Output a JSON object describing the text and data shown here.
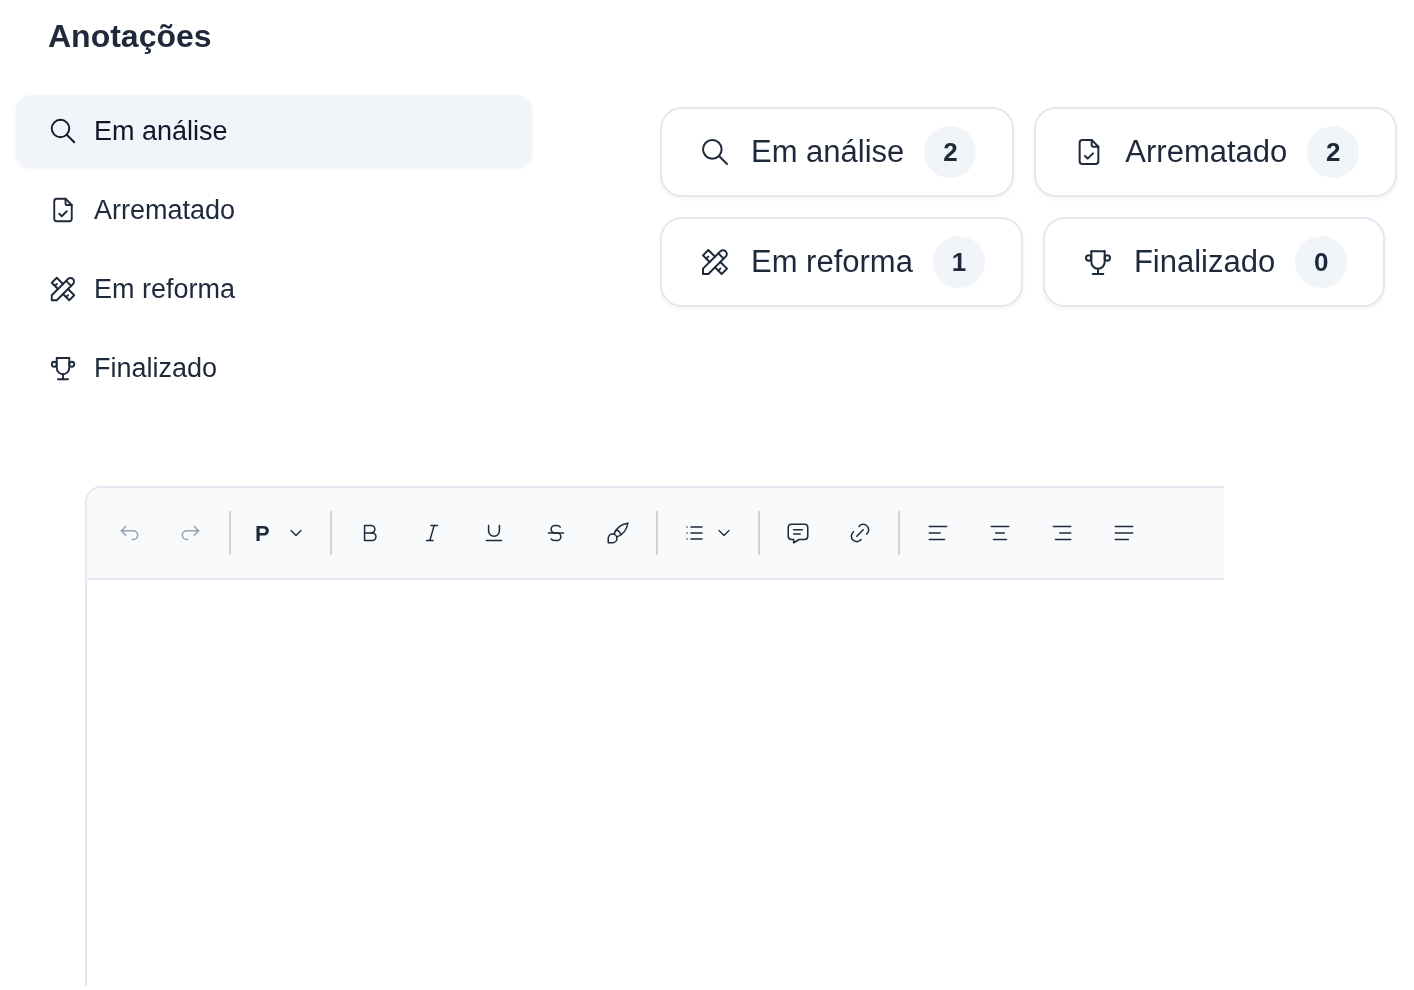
{
  "title": "Anotações",
  "sidebar": {
    "items": [
      {
        "label": "Em análise",
        "selected": true
      },
      {
        "label": "Arrematado",
        "selected": false
      },
      {
        "label": "Em reforma",
        "selected": false
      },
      {
        "label": "Finalizado",
        "selected": false
      }
    ]
  },
  "cards": [
    {
      "label": "Em análise",
      "count": "2"
    },
    {
      "label": "Arrematado",
      "count": "2"
    },
    {
      "label": "Em reforma",
      "count": "1"
    },
    {
      "label": "Finalizado",
      "count": "0"
    }
  ],
  "editor": {
    "toolbar": [
      [
        {
          "kind": "undo",
          "disabled": true
        },
        {
          "kind": "redo",
          "disabled": true
        }
      ],
      [
        {
          "kind": "format",
          "label": "P",
          "disabled": false
        }
      ],
      [
        {
          "kind": "bold",
          "disabled": false
        },
        {
          "kind": "italic",
          "disabled": false
        },
        {
          "kind": "underline",
          "disabled": false
        },
        {
          "kind": "strike",
          "disabled": false
        },
        {
          "kind": "brush",
          "disabled": false
        }
      ],
      [
        {
          "kind": "list",
          "disabled": false
        }
      ],
      [
        {
          "kind": "comment",
          "disabled": false
        },
        {
          "kind": "link",
          "disabled": false
        }
      ],
      [
        {
          "kind": "align-left",
          "disabled": false
        },
        {
          "kind": "align-center",
          "disabled": false
        },
        {
          "kind": "align-right",
          "disabled": false
        },
        {
          "kind": "justify",
          "disabled": false
        }
      ]
    ]
  }
}
